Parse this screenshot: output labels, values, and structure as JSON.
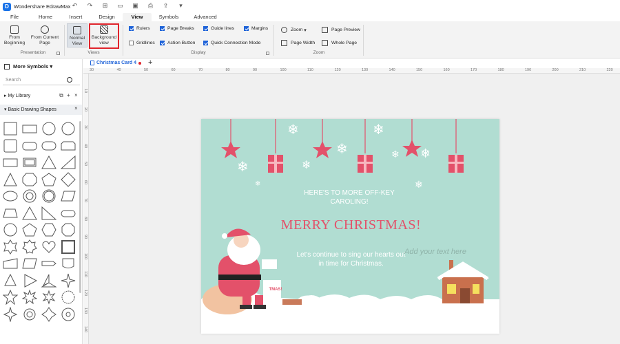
{
  "app": {
    "title": "Wondershare EdrawMax",
    "logo_letter": "D"
  },
  "menu": {
    "tabs": [
      {
        "label": "File"
      },
      {
        "label": "Home"
      },
      {
        "label": "Insert"
      },
      {
        "label": "Design"
      },
      {
        "label": "View"
      },
      {
        "label": "Symbols"
      },
      {
        "label": "Advanced"
      }
    ],
    "active": "View"
  },
  "ribbon": {
    "presentation": {
      "from_beginning": "From Beginning",
      "from_current": "From Current Page",
      "label": "Presentation"
    },
    "views": {
      "normal": "Normal View",
      "background": "Background view",
      "label": "Views"
    },
    "display": {
      "rulers": "Rulers",
      "page_breaks": "Page Breaks",
      "guide_lines": "Guide lines",
      "margins": "Margins",
      "gridlines": "Gridlines",
      "action_button": "Action Button",
      "quick_connection": "Quick Connection Mode",
      "label": "Display"
    },
    "zoom": {
      "zoom": "Zoom",
      "page_preview": "Page Preview",
      "page_width": "Page Width",
      "whole_page": "Whole Page",
      "label": "Zoom"
    }
  },
  "left_panel": {
    "title": "More Symbols",
    "search_placeholder": "Search",
    "my_library": "My Library",
    "section": "Basic Drawing Shapes"
  },
  "document": {
    "tab_name": "Christmas Card 4"
  },
  "ruler": {
    "h_ticks": [
      "30",
      "40",
      "50",
      "60",
      "70",
      "80",
      "90",
      "100",
      "110",
      "120",
      "130",
      "140",
      "150",
      "160",
      "170",
      "180",
      "190",
      "200",
      "210",
      "220"
    ],
    "v_ticks": [
      "10",
      "20",
      "30",
      "40",
      "50",
      "60",
      "70",
      "80",
      "90",
      "100",
      "110",
      "120",
      "130",
      "140"
    ]
  },
  "card": {
    "line1": "HERE'S TO MORE OFF-KEY",
    "line2": "CAROLING!",
    "headline": "MERRY CHRISTMAS!",
    "body1": "Let's continue to sing our hearts out",
    "body2": "in time for Christmas.",
    "placeholder": "Add your text here",
    "tag_text": "TMAS!",
    "colors": {
      "background": "#b1ddd2",
      "accent": "#e3516a",
      "snow": "#ffffff"
    }
  }
}
